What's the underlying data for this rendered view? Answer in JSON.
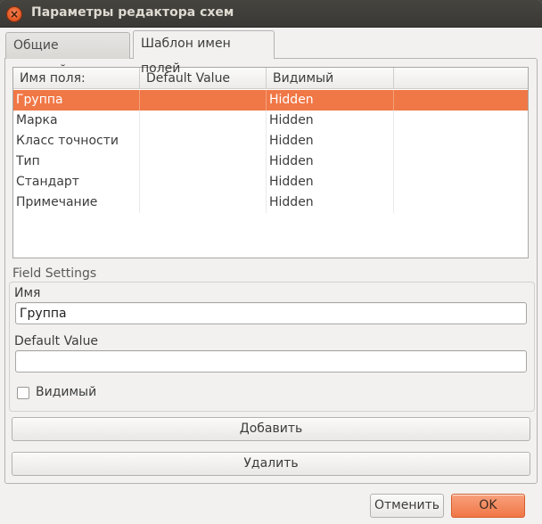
{
  "window": {
    "title": "Параметры редактора схем"
  },
  "tabs": [
    {
      "label": "Общие настройки"
    },
    {
      "label": "Шаблон имен полей"
    }
  ],
  "table": {
    "columns": [
      "Имя поля:",
      "Default Value",
      "Видимый"
    ],
    "rows": [
      {
        "name": "Группа",
        "default": "",
        "visible": "Hidden"
      },
      {
        "name": "Марка",
        "default": "",
        "visible": "Hidden"
      },
      {
        "name": "Класс точности",
        "default": "",
        "visible": "Hidden"
      },
      {
        "name": "Тип",
        "default": "",
        "visible": "Hidden"
      },
      {
        "name": "Стандарт",
        "default": "",
        "visible": "Hidden"
      },
      {
        "name": "Примечание",
        "default": "",
        "visible": "Hidden"
      }
    ],
    "selected_row": "Группа"
  },
  "field_settings": {
    "title": "Field Settings",
    "name_label": "Имя",
    "name_value": "Группа",
    "default_label": "Default Value",
    "default_value": "",
    "visible_label": "Видимый",
    "visible_checked": false
  },
  "buttons": {
    "add": "Добавить",
    "delete": "Удалить",
    "cancel": "Отменить",
    "ok": "OK"
  },
  "colors": {
    "selection": "#f07746",
    "accent": "#e55b25"
  }
}
